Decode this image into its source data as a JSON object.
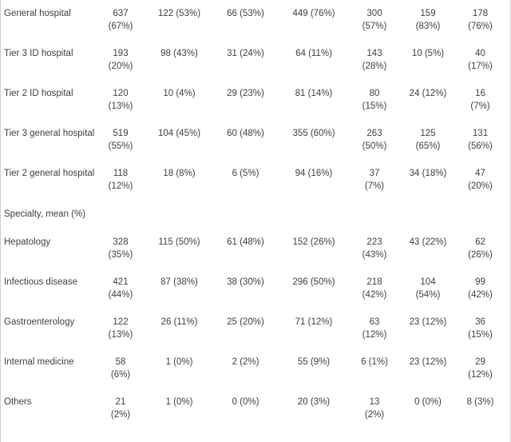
{
  "table": {
    "columns": [
      "label",
      "col1",
      "col2",
      "col3",
      "col4",
      "col5",
      "col6",
      "col7"
    ],
    "rows": [
      {
        "type": "data",
        "label": "General hospital",
        "cells": [
          {
            "value": "637",
            "pct": "(67%)",
            "split": true
          },
          {
            "value": "122 (53%)",
            "pct": "",
            "split": false
          },
          {
            "value": "66 (53%)",
            "pct": "",
            "split": false
          },
          {
            "value": "449 (76%)",
            "pct": "",
            "split": false
          },
          {
            "value": "300",
            "pct": "(57%)",
            "split": true
          },
          {
            "value": "159",
            "pct": "(83%)",
            "split": true
          },
          {
            "value": "178",
            "pct": "(76%)",
            "split": true
          }
        ]
      },
      {
        "type": "data",
        "label": "Tier 3 ID hospital",
        "cells": [
          {
            "value": "193",
            "pct": "(20%)",
            "split": true
          },
          {
            "value": "98 (43%)",
            "pct": "",
            "split": false
          },
          {
            "value": "31 (24%)",
            "pct": "",
            "split": false
          },
          {
            "value": "64 (11%)",
            "pct": "",
            "split": false
          },
          {
            "value": "143",
            "pct": "(28%)",
            "split": true
          },
          {
            "value": "10 (5%)",
            "pct": "",
            "split": false
          },
          {
            "value": "40",
            "pct": "(17%)",
            "split": true
          }
        ]
      },
      {
        "type": "data",
        "label": "Tier 2 ID hospital",
        "cells": [
          {
            "value": "120",
            "pct": "(13%)",
            "split": true
          },
          {
            "value": "10 (4%)",
            "pct": "",
            "split": false
          },
          {
            "value": "29 (23%)",
            "pct": "",
            "split": false
          },
          {
            "value": "81 (14%)",
            "pct": "",
            "split": false
          },
          {
            "value": "80",
            "pct": "(15%)",
            "split": true
          },
          {
            "value": "24 (12%)",
            "pct": "",
            "split": false
          },
          {
            "value": "16",
            "pct": "(7%)",
            "split": true
          }
        ]
      },
      {
        "type": "data",
        "label": "Tier 3 general hospital",
        "cells": [
          {
            "value": "519",
            "pct": "(55%)",
            "split": true
          },
          {
            "value": "104 (45%)",
            "pct": "",
            "split": false
          },
          {
            "value": "60 (48%)",
            "pct": "",
            "split": false
          },
          {
            "value": "355 (60%)",
            "pct": "",
            "split": false
          },
          {
            "value": "263",
            "pct": "(50%)",
            "split": true
          },
          {
            "value": "125",
            "pct": "(65%)",
            "split": true
          },
          {
            "value": "131",
            "pct": "(56%)",
            "split": true
          }
        ]
      },
      {
        "type": "data",
        "label": "Tier 2 general hospital",
        "cells": [
          {
            "value": "118",
            "pct": "(12%)",
            "split": true
          },
          {
            "value": "18 (8%)",
            "pct": "",
            "split": false
          },
          {
            "value": "6 (5%)",
            "pct": "",
            "split": false
          },
          {
            "value": "94 (16%)",
            "pct": "",
            "split": false
          },
          {
            "value": "37",
            "pct": "(7%)",
            "split": true
          },
          {
            "value": "34 (18%)",
            "pct": "",
            "split": false
          },
          {
            "value": "47",
            "pct": "(20%)",
            "split": true
          }
        ]
      },
      {
        "type": "section",
        "label": "Specialty, mean (%)",
        "cells": []
      },
      {
        "type": "data",
        "label": "Hepatology",
        "cells": [
          {
            "value": "328",
            "pct": "(35%)",
            "split": true
          },
          {
            "value": "115 (50%)",
            "pct": "",
            "split": false
          },
          {
            "value": "61 (48%)",
            "pct": "",
            "split": false
          },
          {
            "value": "152 (26%)",
            "pct": "",
            "split": false
          },
          {
            "value": "223",
            "pct": "(43%)",
            "split": true
          },
          {
            "value": "43 (22%)",
            "pct": "",
            "split": false
          },
          {
            "value": "62",
            "pct": "(26%)",
            "split": true
          }
        ]
      },
      {
        "type": "data",
        "label": "Infectious disease",
        "cells": [
          {
            "value": "421",
            "pct": "(44%)",
            "split": true
          },
          {
            "value": "87 (38%)",
            "pct": "",
            "split": false
          },
          {
            "value": "38 (30%)",
            "pct": "",
            "split": false
          },
          {
            "value": "296 (50%)",
            "pct": "",
            "split": false
          },
          {
            "value": "218",
            "pct": "(42%)",
            "split": true
          },
          {
            "value": "104",
            "pct": "(54%)",
            "split": true
          },
          {
            "value": "99",
            "pct": "(42%)",
            "split": true
          }
        ]
      },
      {
        "type": "data",
        "label": "Gastroenterology",
        "cells": [
          {
            "value": "122",
            "pct": "(13%)",
            "split": true
          },
          {
            "value": "26 (11%)",
            "pct": "",
            "split": false
          },
          {
            "value": "25 (20%)",
            "pct": "",
            "split": false
          },
          {
            "value": "71 (12%)",
            "pct": "",
            "split": false
          },
          {
            "value": "63",
            "pct": "(12%)",
            "split": true
          },
          {
            "value": "23 (12%)",
            "pct": "",
            "split": false
          },
          {
            "value": "36",
            "pct": "(15%)",
            "split": true
          }
        ]
      },
      {
        "type": "data",
        "label": "Internal medicine",
        "cells": [
          {
            "value": "58",
            "pct": "(6%)",
            "split": true
          },
          {
            "value": "1 (0%)",
            "pct": "",
            "split": false
          },
          {
            "value": "2 (2%)",
            "pct": "",
            "split": false
          },
          {
            "value": "55 (9%)",
            "pct": "",
            "split": false
          },
          {
            "value": "6 (1%)",
            "pct": "",
            "split": false
          },
          {
            "value": "23 (12%)",
            "pct": "",
            "split": false
          },
          {
            "value": "29",
            "pct": "(12%)",
            "split": true
          }
        ]
      },
      {
        "type": "data",
        "label": "Others",
        "cells": [
          {
            "value": "21",
            "pct": "(2%)",
            "split": true
          },
          {
            "value": "1 (0%)",
            "pct": "",
            "split": false
          },
          {
            "value": "0 (0%)",
            "pct": "",
            "split": false
          },
          {
            "value": "20 (3%)",
            "pct": "",
            "split": false
          },
          {
            "value": "13",
            "pct": "(2%)",
            "split": true
          },
          {
            "value": "0 (0%)",
            "pct": "",
            "split": false
          },
          {
            "value": "8 (3%)",
            "pct": "",
            "split": false
          }
        ]
      }
    ]
  },
  "style": {
    "text_color": "#3f3f3f",
    "border_color": "#d0d0d0",
    "background": "#ffffff"
  }
}
